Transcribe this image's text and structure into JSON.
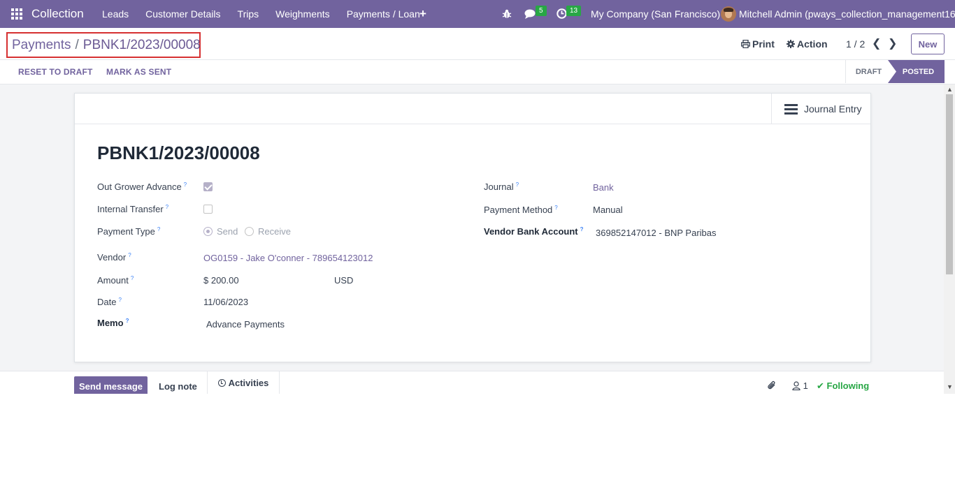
{
  "navbar": {
    "app_name": "Collection",
    "menu": [
      "Leads",
      "Customer Details",
      "Trips",
      "Weighments",
      "Payments / Loan"
    ],
    "plus": "+",
    "messages_count": "5",
    "activities_count": "13",
    "company": "My Company (San Francisco)",
    "user": "Mitchell Admin (pways_collection_management16)"
  },
  "control": {
    "breadcrumb_parent": "Payments",
    "breadcrumb_sep": "/",
    "breadcrumb_current": "PBNK1/2023/00008",
    "print_label": "Print",
    "action_label": "Action",
    "pager": "1 / 2",
    "new_label": "New"
  },
  "statusbar": {
    "reset_label": "Reset to Draft",
    "mark_sent_label": "Mark as Sent",
    "stages": [
      "DRAFT",
      "POSTED"
    ],
    "current_stage": "POSTED"
  },
  "form": {
    "journal_entry_label": "Journal Entry",
    "title": "PBNK1/2023/00008",
    "fields": {
      "out_grower_label": "Out Grower Advance",
      "out_grower_value": true,
      "internal_transfer_label": "Internal Transfer",
      "internal_transfer_value": false,
      "payment_type_label": "Payment Type",
      "payment_type_options": [
        "Send",
        "Receive"
      ],
      "payment_type_value": "Send",
      "vendor_label": "Vendor",
      "vendor_value": "OG0159 - Jake O'conner - 789654123012",
      "amount_label": "Amount",
      "amount_value": "$ 200.00",
      "currency_value": "USD",
      "date_label": "Date",
      "date_value": "11/06/2023",
      "memo_label": "Memo",
      "memo_value": "Advance Payments",
      "journal_label": "Journal",
      "journal_value": "Bank",
      "payment_method_label": "Payment Method",
      "payment_method_value": "Manual",
      "vendor_bank_label": "Vendor Bank Account",
      "vendor_bank_value": "369852147012 - BNP Paribas",
      "help_mark": "?"
    }
  },
  "chatter": {
    "send_message_label": "Send message",
    "log_note_label": "Log note",
    "activities_label": "Activities",
    "followers_count": "1",
    "following_label": "Following"
  },
  "colors": {
    "brand": "#71639e",
    "success": "#28a745",
    "highlight_border": "#d63031"
  }
}
